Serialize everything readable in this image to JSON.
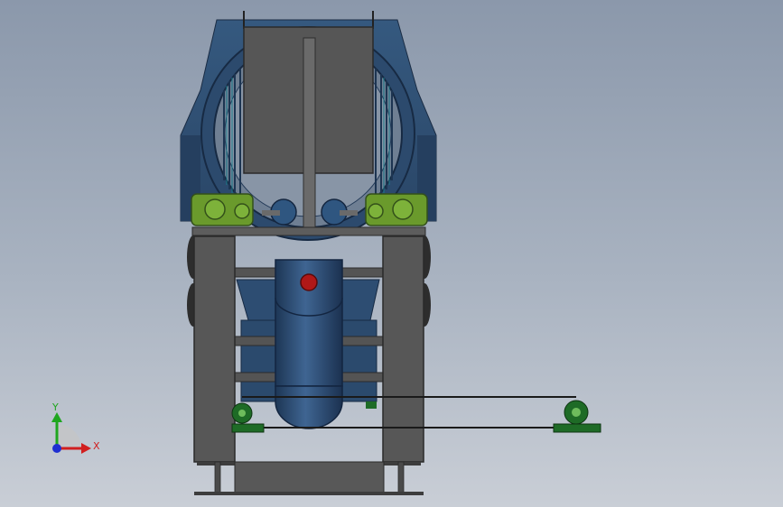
{
  "triad": {
    "x_label": "X",
    "y_label": "Y",
    "x_color": "#d11f1f",
    "y_color": "#1fa61f",
    "z_color": "#1f2fd1"
  },
  "colors": {
    "background_top": "#8b98ab",
    "background_bottom": "#c9ced6",
    "body_blue": "#2e4d73",
    "frame_gray": "#555555",
    "motor_green": "#6a9a2c",
    "base_green": "#1e6b26",
    "center_hole": "#b01818"
  }
}
